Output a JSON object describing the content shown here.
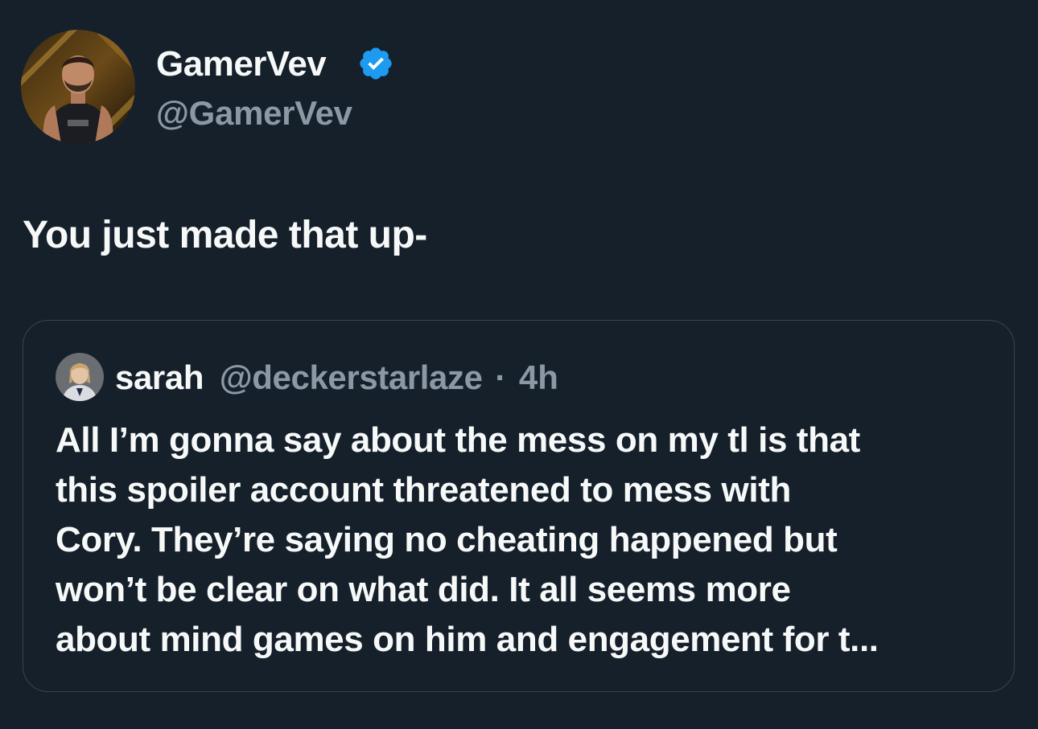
{
  "author": {
    "name": "GamerVev",
    "handle": "@GamerVev",
    "verified": true
  },
  "tweet": {
    "text": "You just made that up-"
  },
  "quoted_tweet": {
    "author_name": "sarah",
    "author_handle": "@deckerstarlaze",
    "separator": "·",
    "time": "4h",
    "text_lines": [
      "All I’m gonna say about the mess on my tl is that",
      "this spoiler account threatened to mess with",
      "Cory. They’re saying no cheating happened but",
      "won’t be clear on what did. It all seems more",
      "about mind games on him and engagement for t..."
    ]
  },
  "colors": {
    "background": "#15202b",
    "primary_text": "#f7f9f9",
    "secondary_text": "#8b98a5",
    "border": "#38444d",
    "verified_blue": "#1d9bf0"
  },
  "icons": {
    "verified": "verified-badge-icon"
  }
}
